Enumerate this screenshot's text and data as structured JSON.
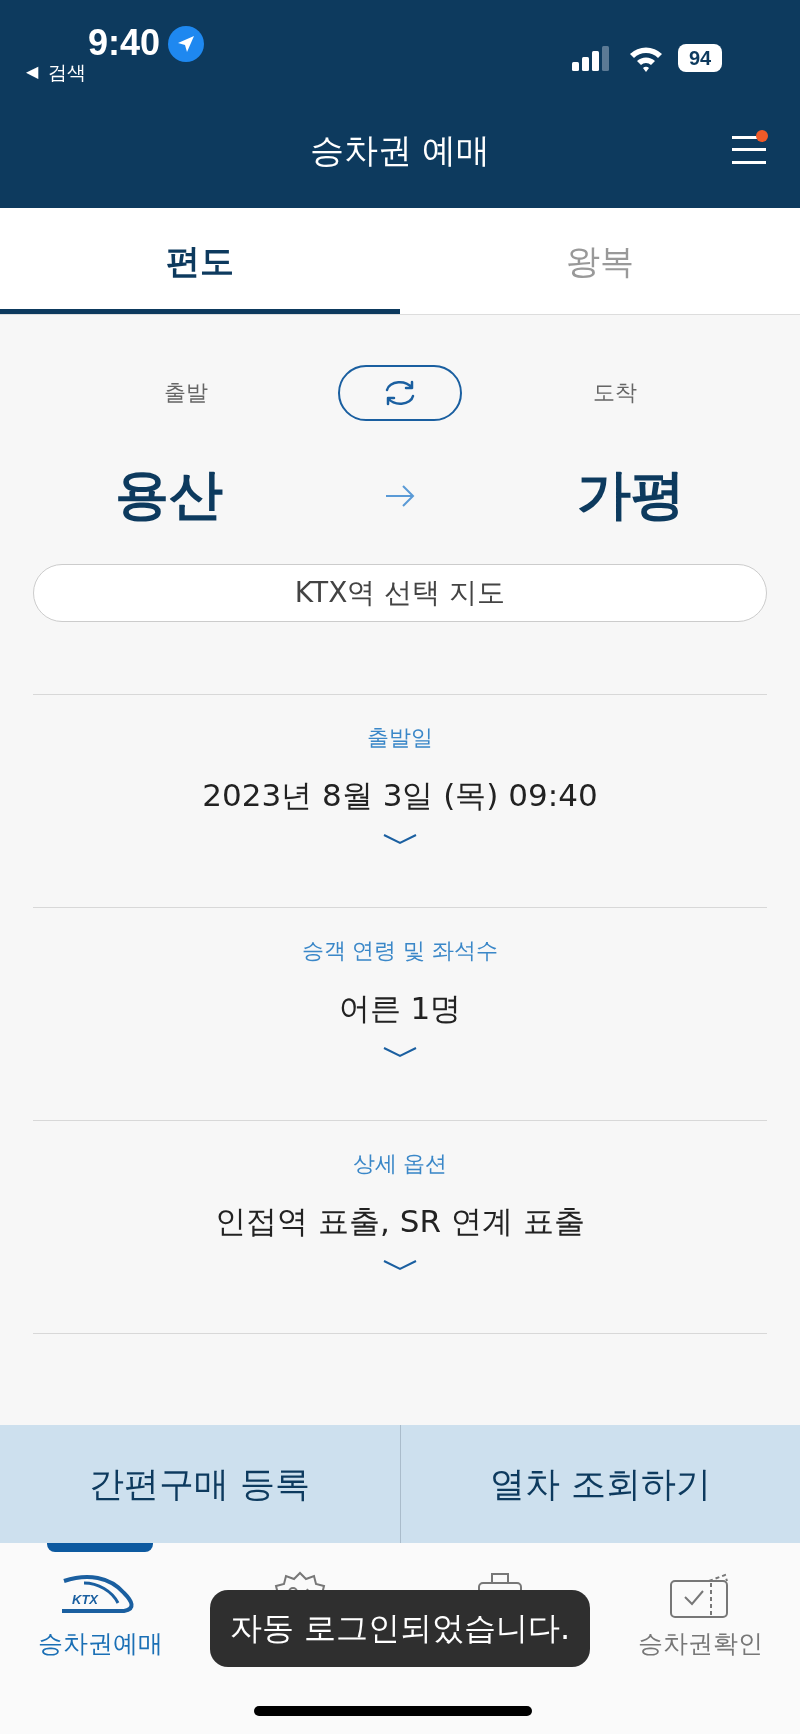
{
  "status_bar": {
    "time": "9:40",
    "back_arrow": "◀",
    "back_label": "검색",
    "battery": "94"
  },
  "header": {
    "title": "승차권 예매",
    "menu_badge": true
  },
  "tabs": [
    {
      "label": "편도",
      "selected": true
    },
    {
      "label": "왕복",
      "selected": false
    }
  ],
  "route": {
    "departure_label": "출발",
    "arrival_label": "도착",
    "departure": "용산",
    "arrival": "가평",
    "map_button": "KTX역 선택 지도"
  },
  "options": [
    {
      "label": "출발일",
      "value": "2023년 8월 3일 (목) 09:40"
    },
    {
      "label": "승객 연령 및 좌석수",
      "value": "어른 1명"
    },
    {
      "label": "상세 옵션",
      "value": "인접역 표출, SR 연계 표출"
    }
  ],
  "actions": [
    "간편구매 등록",
    "열차 조회하기"
  ],
  "nav": [
    {
      "kind": "ktx",
      "label": "승차권예매",
      "logo_text": "KTX",
      "selected": true
    },
    {
      "kind": "discount",
      "selected": false
    },
    {
      "kind": "luggage",
      "selected": false
    },
    {
      "kind": "ticket",
      "label": "승차권확인",
      "selected": false
    }
  ],
  "toast": "자동 로그인되었습니다."
}
